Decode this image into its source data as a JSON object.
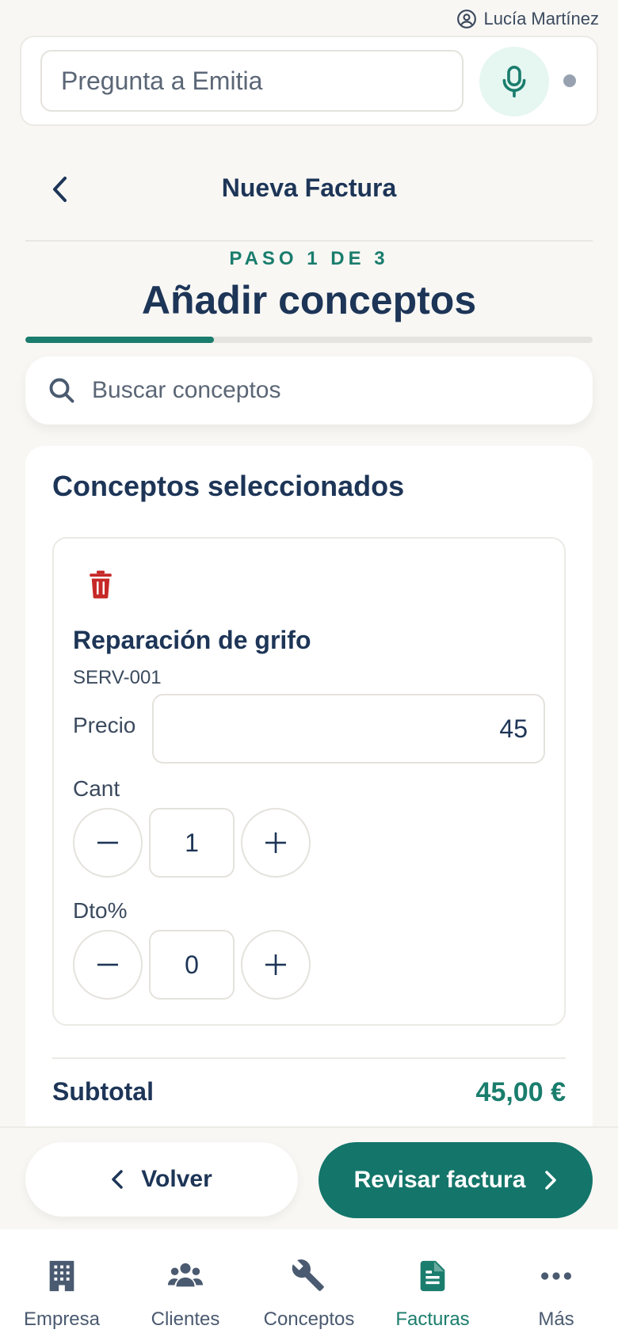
{
  "user": {
    "name": "Lucía Martínez",
    "icon": "user-circle-icon"
  },
  "assistant": {
    "placeholder": "Pregunta a Emitia",
    "mic_icon": "microphone-icon"
  },
  "header": {
    "title": "Nueva Factura",
    "back_icon": "chevron-left-icon"
  },
  "wizard": {
    "step_label": "PASO 1 DE 3",
    "step_title": "Añadir conceptos",
    "progress_fraction": 0.333
  },
  "search": {
    "placeholder": "Buscar conceptos",
    "icon": "search-icon"
  },
  "selected": {
    "title": "Conceptos seleccionados",
    "items": [
      {
        "name": "Reparación de grifo",
        "code": "SERV-001",
        "price_label": "Precio",
        "price": "45",
        "qty_label": "Cant",
        "qty": "1",
        "discount_label": "Dto%",
        "discount": "0"
      }
    ],
    "subtotal_label": "Subtotal",
    "subtotal_value": "45,00 €"
  },
  "actions": {
    "back_label": "Volver",
    "review_label": "Revisar factura"
  },
  "tabs": [
    {
      "label": "Empresa",
      "icon": "building-icon",
      "active": false
    },
    {
      "label": "Clientes",
      "icon": "people-icon",
      "active": false
    },
    {
      "label": "Conceptos",
      "icon": "wrench-icon",
      "active": false
    },
    {
      "label": "Facturas",
      "icon": "document-icon",
      "active": true
    },
    {
      "label": "Más",
      "icon": "more-dots-icon",
      "active": false
    }
  ],
  "colors": {
    "accent": "#1a7d6d",
    "primary_button": "#14756a",
    "text": "#1d3557",
    "danger": "#c62828"
  }
}
